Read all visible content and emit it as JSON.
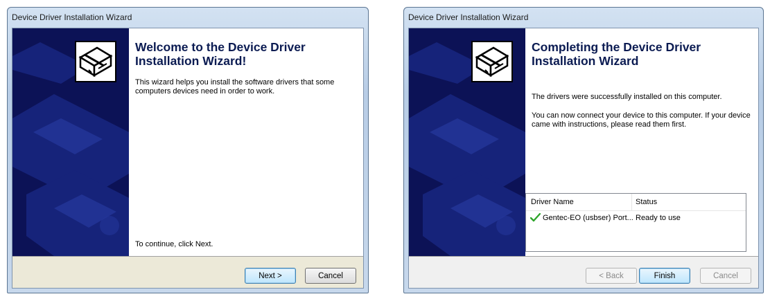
{
  "window1": {
    "title": "Device Driver Installation Wizard",
    "heading_line1": "Welcome to the Device Driver",
    "heading_line2": "Installation Wizard!",
    "description_line1": "This wizard helps you install the software drivers that some",
    "description_line2": "computers devices need in order to work.",
    "continue_text": "To continue, click Next.",
    "next_label": "Next >",
    "cancel_label": "Cancel",
    "icon": "hardware-device-icon"
  },
  "window2": {
    "title": "Device Driver Installation Wizard",
    "heading_line1": "Completing the Device Driver",
    "heading_line2": "Installation Wizard",
    "success_text": "The drivers were successfully installed on this computer.",
    "instructions_line1": "You can now connect your device to this computer. If your device",
    "instructions_line2": "came with instructions, please read them first.",
    "table": {
      "columns": [
        "Driver Name",
        "Status"
      ],
      "rows": [
        {
          "driver_name": "Gentec-EO (usbser) Port...",
          "status": "Ready to use",
          "icon": "green-check-icon"
        }
      ]
    },
    "back_label": "< Back",
    "finish_label": "Finish",
    "cancel_label": "Cancel",
    "icon": "hardware-device-icon"
  },
  "colors": {
    "sidebar": "#0c1256",
    "heading": "#0b1b52",
    "check": "#2ea52b"
  }
}
